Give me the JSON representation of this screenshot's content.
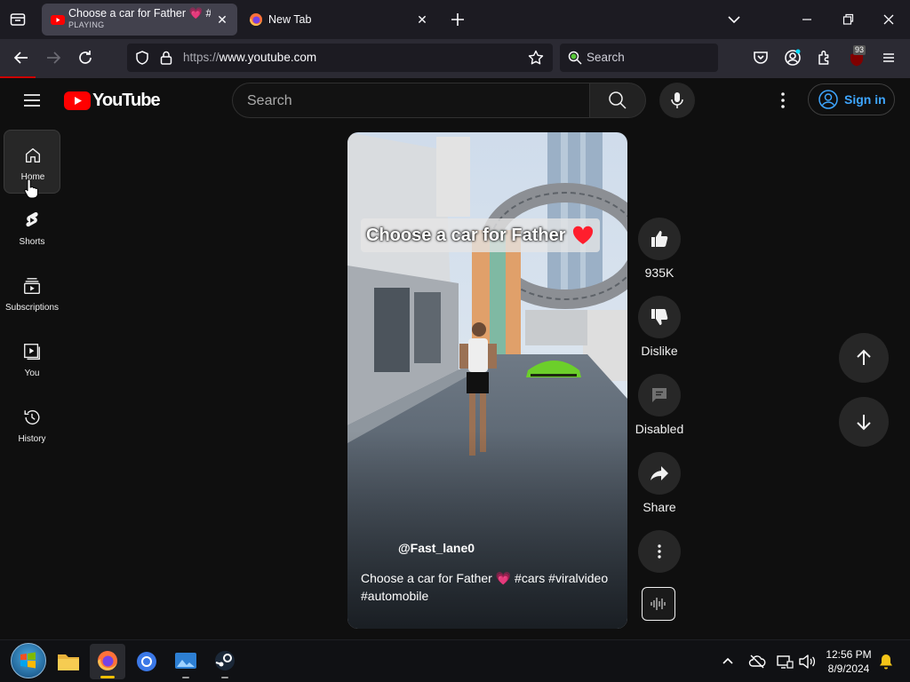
{
  "browser": {
    "tabs": [
      {
        "title": "Choose a car for Father 💗 #cars #viralvideo",
        "status": "PLAYING",
        "active": true
      },
      {
        "title": "New Tab",
        "active": false
      }
    ],
    "url_scheme": "https://",
    "url_host": "www.youtube.com",
    "search_placeholder": "Search",
    "extension_badge": "93"
  },
  "youtube": {
    "logo_text": "YouTube",
    "search_placeholder": "Search",
    "sign_in_label": "Sign in",
    "sidebar": [
      {
        "label": "Home",
        "icon": "home-icon"
      },
      {
        "label": "Shorts",
        "icon": "shorts-icon"
      },
      {
        "label": "Subscriptions",
        "icon": "subscriptions-icon"
      },
      {
        "label": "You",
        "icon": "you-icon"
      },
      {
        "label": "History",
        "icon": "history-icon"
      }
    ],
    "short": {
      "overlay_title": "Choose a car for Father",
      "channel": "@Fast_lane0",
      "caption": "Choose a car for Father 💗 #cars #viralvideo #automobile"
    },
    "actions": {
      "likes": "935K",
      "dislike": "Dislike",
      "comments": "Disabled",
      "share": "Share"
    }
  },
  "taskbar": {
    "time": "12:56 PM",
    "date": "8/9/2024"
  },
  "colors": {
    "yt_red": "#ff0000",
    "link_blue": "#3ea6ff",
    "accent_line": "#cc0000",
    "firefox_active_tab": "#42414d"
  }
}
